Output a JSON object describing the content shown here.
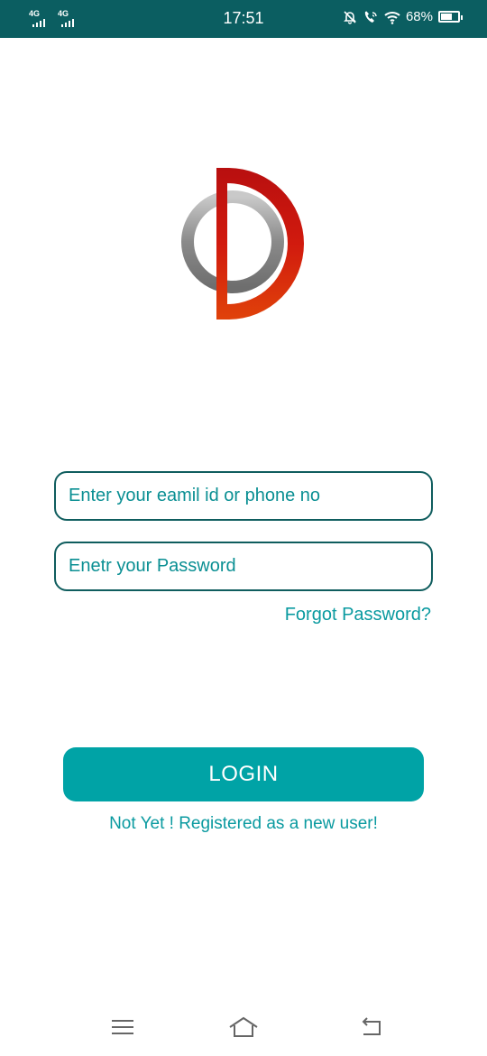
{
  "status_bar": {
    "network_1": "4G",
    "network_2": "4G",
    "time": "17:51",
    "battery_percent": "68%",
    "battery_level": 0.68,
    "icons": [
      "mute-bell-icon",
      "wifi-calling-icon",
      "wifi-icon",
      "battery-icon"
    ],
    "background_color": "#0b5e61"
  },
  "logo": {
    "icon": "app-logo-icon",
    "colors": {
      "ring": "#9a9a9a",
      "d_shape": "#c8160f"
    }
  },
  "form": {
    "email_placeholder": "Enter your eamil id or phone no",
    "email_value": "",
    "password_placeholder": "Enetr your Password",
    "password_value": "",
    "forgot_password": "Forgot Password?",
    "login_label": "LOGIN",
    "register_link": "Not Yet ! Registered as a new user!",
    "accent_color": "#00a3a6",
    "border_color": "#0f5d5e"
  },
  "nav": {
    "icons": [
      "menu-icon",
      "home-icon",
      "back-icon"
    ]
  }
}
